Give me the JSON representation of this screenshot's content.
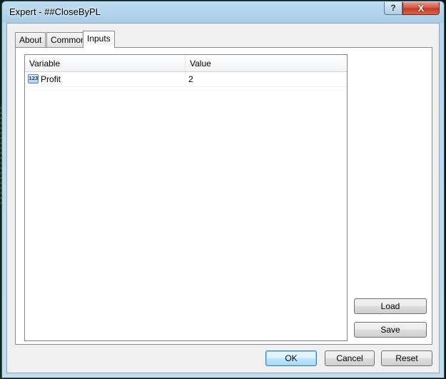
{
  "window": {
    "title": "Expert - ##CloseByPL",
    "help_label": "?",
    "close_label": "X"
  },
  "tabs": [
    {
      "label": "About",
      "active": false
    },
    {
      "label": "Common",
      "active": false
    },
    {
      "label": "Inputs",
      "active": true
    }
  ],
  "inputs_table": {
    "columns": [
      "Variable",
      "Value"
    ],
    "rows": [
      {
        "icon": "integer-type-icon",
        "icon_text": "123",
        "variable": "Profit",
        "value": "2"
      }
    ]
  },
  "side_buttons": {
    "load_label": "Load",
    "save_label": "Save"
  },
  "footer_buttons": {
    "ok_label": "OK",
    "cancel_label": "Cancel",
    "reset_label": "Reset"
  }
}
